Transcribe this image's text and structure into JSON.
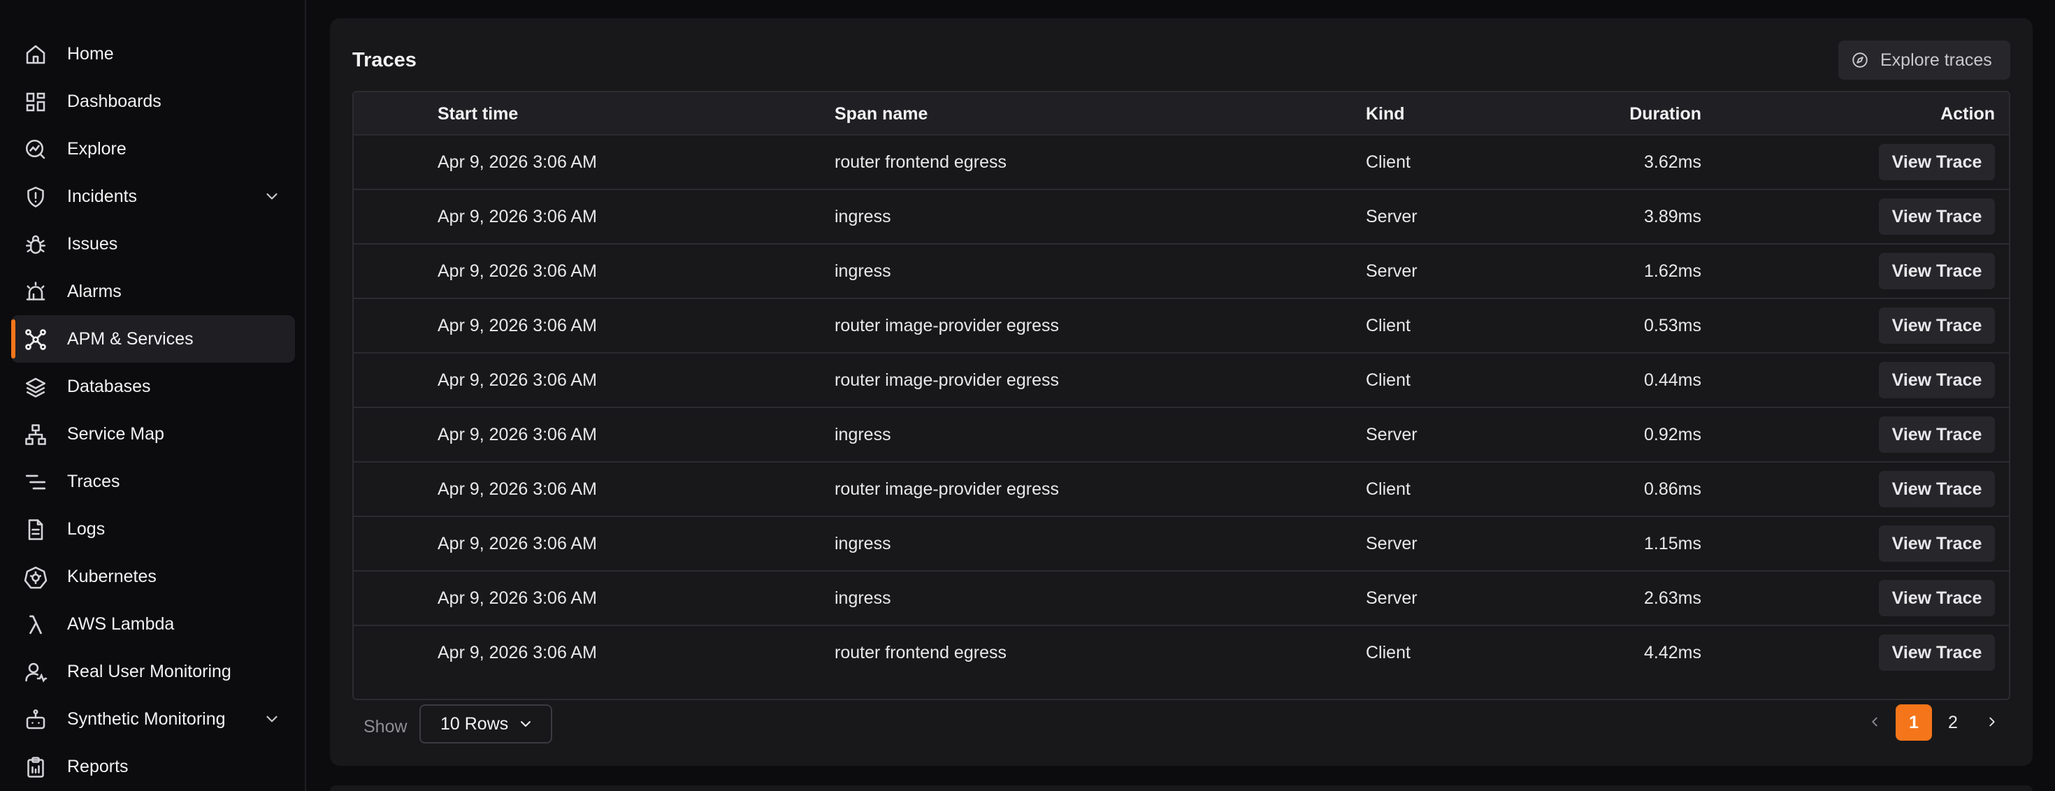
{
  "sidebar": {
    "items": [
      {
        "label": "Home",
        "icon": "home-icon"
      },
      {
        "label": "Dashboards",
        "icon": "dashboard-grid-icon"
      },
      {
        "label": "Explore",
        "icon": "explore-chart-icon"
      },
      {
        "label": "Incidents",
        "icon": "shield-alert-icon",
        "expandable": true
      },
      {
        "label": "Issues",
        "icon": "bug-icon"
      },
      {
        "label": "Alarms",
        "icon": "siren-icon"
      },
      {
        "label": "APM & Services",
        "icon": "network-nodes-icon",
        "active": true
      },
      {
        "label": "Databases",
        "icon": "layers-icon"
      },
      {
        "label": "Service Map",
        "icon": "service-map-icon"
      },
      {
        "label": "Traces",
        "icon": "traces-icon"
      },
      {
        "label": "Logs",
        "icon": "file-text-icon"
      },
      {
        "label": "Kubernetes",
        "icon": "kubernetes-icon"
      },
      {
        "label": "AWS Lambda",
        "icon": "lambda-icon"
      },
      {
        "label": "Real User Monitoring",
        "icon": "user-monitoring-icon"
      },
      {
        "label": "Synthetic Monitoring",
        "icon": "robot-icon",
        "expandable": true
      },
      {
        "label": "Reports",
        "icon": "clipboard-icon"
      }
    ]
  },
  "panel": {
    "title": "Traces",
    "explore_button": "Explore traces"
  },
  "table": {
    "columns": [
      "Start time",
      "Span name",
      "Kind",
      "Duration",
      "Action"
    ],
    "action_label": "View Trace",
    "rows": [
      {
        "start": "Apr 9, 2026 3:06 AM",
        "span": "router frontend egress",
        "kind": "Client",
        "duration": "3.62ms"
      },
      {
        "start": "Apr 9, 2026 3:06 AM",
        "span": "ingress",
        "kind": "Server",
        "duration": "3.89ms"
      },
      {
        "start": "Apr 9, 2026 3:06 AM",
        "span": "ingress",
        "kind": "Server",
        "duration": "1.62ms"
      },
      {
        "start": "Apr 9, 2026 3:06 AM",
        "span": "router image-provider egress",
        "kind": "Client",
        "duration": "0.53ms"
      },
      {
        "start": "Apr 9, 2026 3:06 AM",
        "span": "router image-provider egress",
        "kind": "Client",
        "duration": "0.44ms"
      },
      {
        "start": "Apr 9, 2026 3:06 AM",
        "span": "ingress",
        "kind": "Server",
        "duration": "0.92ms"
      },
      {
        "start": "Apr 9, 2026 3:06 AM",
        "span": "router image-provider egress",
        "kind": "Client",
        "duration": "0.86ms"
      },
      {
        "start": "Apr 9, 2026 3:06 AM",
        "span": "ingress",
        "kind": "Server",
        "duration": "1.15ms"
      },
      {
        "start": "Apr 9, 2026 3:06 AM",
        "span": "ingress",
        "kind": "Server",
        "duration": "2.63ms"
      },
      {
        "start": "Apr 9, 2026 3:06 AM",
        "span": "router frontend egress",
        "kind": "Client",
        "duration": "4.42ms"
      }
    ]
  },
  "footer": {
    "show_label": "Show",
    "rows_value": "10 Rows",
    "pages": [
      "1",
      "2"
    ],
    "current_page": "1"
  },
  "colors": {
    "accent": "#f5761a",
    "background": "#0c0c0e",
    "panel": "#18181b"
  }
}
